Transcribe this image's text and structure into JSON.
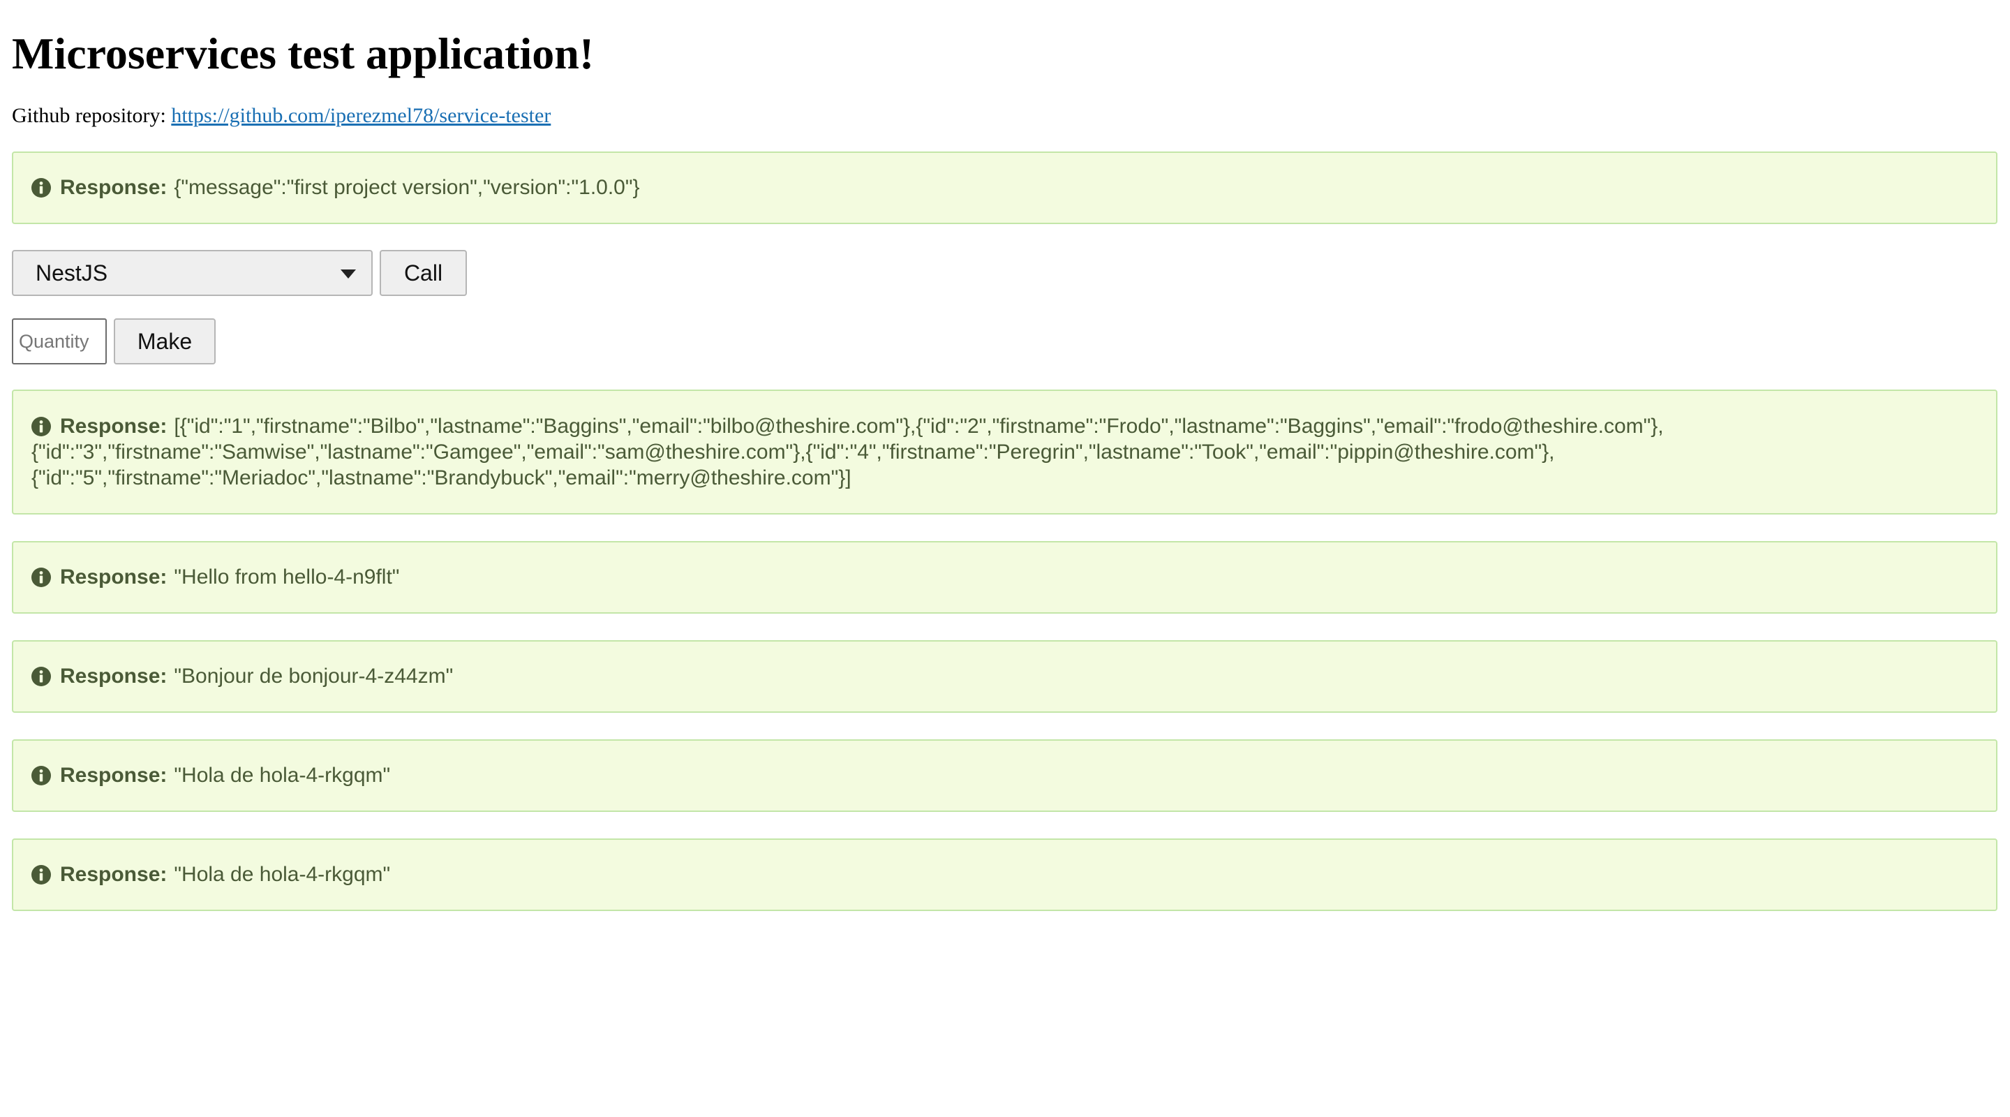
{
  "header": {
    "title": "Microservices test application!",
    "repo_prefix": "Github repository:",
    "repo_link": "https://github.com/iperezmel78/service-tester"
  },
  "response_label": "Response:",
  "version_response": "{\"message\":\"first project version\",\"version\":\"1.0.0\"}",
  "service_select": {
    "selected": "NestJS"
  },
  "call_button": "Call",
  "quantity_input": {
    "placeholder": "Quantity",
    "value": ""
  },
  "make_button": "Make",
  "responses": [
    {
      "lines": [
        "[{\"id\":\"1\",\"firstname\":\"Bilbo\",\"lastname\":\"Baggins\",\"email\":\"bilbo@theshire.com\"},{\"id\":\"2\",\"firstname\":\"Frodo\",\"lastname\":\"Baggins\",\"email\":\"frodo@theshire.com\"},",
        "{\"id\":\"3\",\"firstname\":\"Samwise\",\"lastname\":\"Gamgee\",\"email\":\"sam@theshire.com\"},{\"id\":\"4\",\"firstname\":\"Peregrin\",\"lastname\":\"Took\",\"email\":\"pippin@theshire.com\"},",
        "{\"id\":\"5\",\"firstname\":\"Meriadoc\",\"lastname\":\"Brandybuck\",\"email\":\"merry@theshire.com\"}]"
      ]
    },
    {
      "text": "\"Hello from hello-4-n9flt\""
    },
    {
      "text": "\"Bonjour de bonjour-4-z44zm\""
    },
    {
      "text": "\"Hola de hola-4-rkgqm\""
    },
    {
      "text": "\"Hola de hola-4-rkgqm\""
    }
  ],
  "icons": {
    "info": "info-circle-icon",
    "dropdown": "caret-down-icon"
  },
  "colors": {
    "alert_background": "#f3fbdf",
    "alert_border": "#c3e6a8",
    "alert_text": "#4a5a37",
    "link": "#1a6fb3"
  }
}
